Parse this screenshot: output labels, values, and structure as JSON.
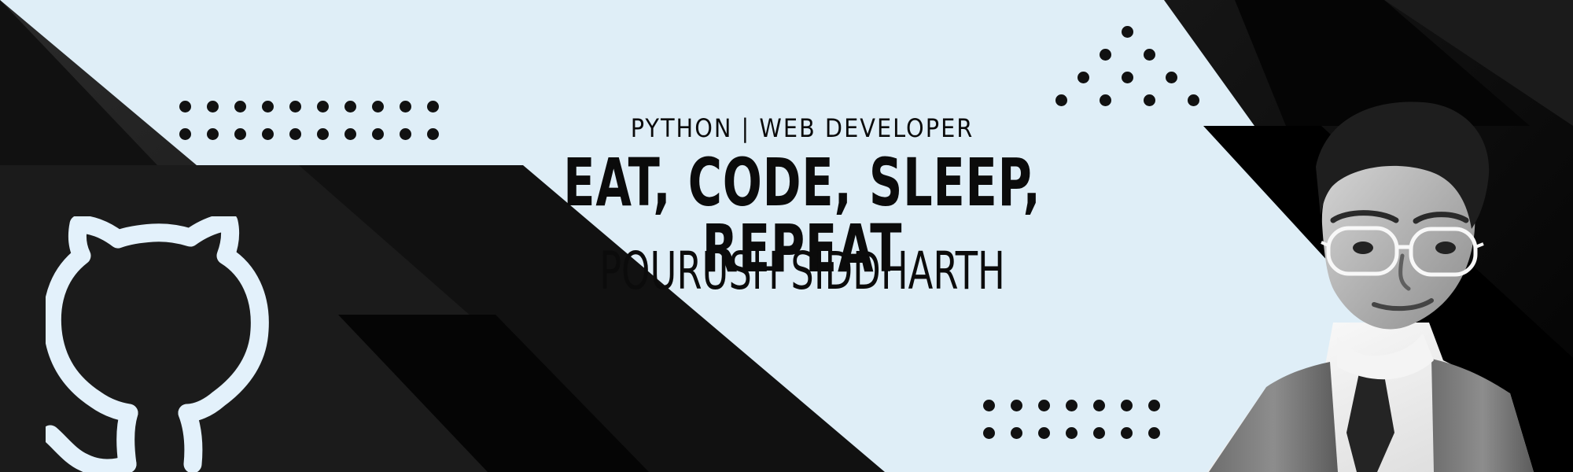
{
  "banner": {
    "subtitle": "PYTHON | WEB DEVELOPER",
    "headline": "EAT, CODE, SLEEP, REPEAT",
    "name": "POURUSH SIDDHARTH"
  },
  "colors": {
    "background": "#dfeef7",
    "dark": "#111111",
    "black": "#000000",
    "text": "#0b0b0b",
    "accent_light": "#e3f1fb"
  },
  "icons": {
    "github": "github-cat-icon",
    "dots": "dot-pattern-icon",
    "portrait": "profile-photo"
  }
}
